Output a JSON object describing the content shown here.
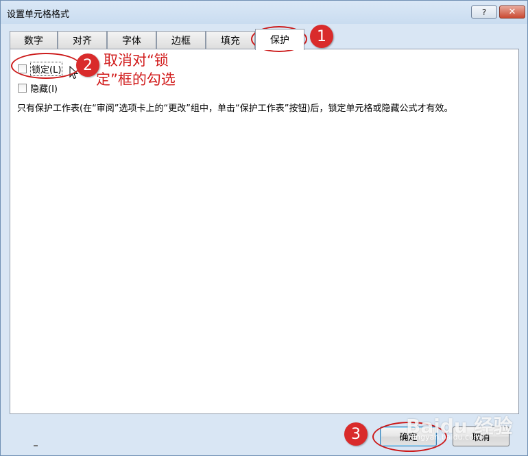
{
  "dialog": {
    "title": "设置单元格格式",
    "help_icon": "?",
    "close_icon": "✕"
  },
  "tabs": [
    {
      "label": "数字",
      "active": false
    },
    {
      "label": "对齐",
      "active": false
    },
    {
      "label": "字体",
      "active": false
    },
    {
      "label": "边框",
      "active": false
    },
    {
      "label": "填充",
      "active": false
    },
    {
      "label": "保护",
      "active": true
    }
  ],
  "protection": {
    "locked": {
      "label": "锁定(L)",
      "checked": false
    },
    "hidden": {
      "label": "隐藏(I)",
      "checked": false
    },
    "description": "只有保护工作表(在“审阅”选项卡上的“更改”组中，单击“保护工作表”按钮)后，锁定单元格或隐藏公式才有效。"
  },
  "buttons": {
    "ok": "确定",
    "cancel": "取消"
  },
  "annotations": {
    "step1": "1",
    "step2": "2",
    "step3": "3",
    "note_line1": "取消对“锁",
    "note_line2": "定”框的勾选",
    "color": "#d92b2b"
  },
  "watermark": {
    "text": "Baidu 经验",
    "sub": "jingyan.baidu.com"
  }
}
